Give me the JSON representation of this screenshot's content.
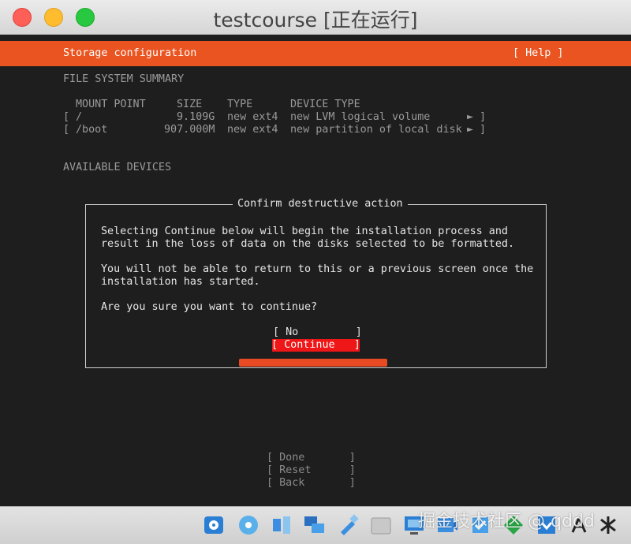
{
  "window": {
    "title": "testcourse [正在运行]"
  },
  "header": {
    "title": "Storage configuration",
    "help": "[ Help ]"
  },
  "fs_summary": {
    "heading": "FILE SYSTEM SUMMARY",
    "columns": [
      "MOUNT POINT",
      "SIZE",
      "TYPE",
      "DEVICE TYPE"
    ],
    "rows": [
      {
        "open": "[",
        "mount": "/",
        "size": "9.109G",
        "type": "new ext4",
        "device": "new LVM logical volume",
        "arrow": "►",
        "close": "]"
      },
      {
        "open": "[",
        "mount": "/boot",
        "size": "907.000M",
        "type": "new ext4",
        "device": "new partition of local disk",
        "arrow": "►",
        "close": "]"
      }
    ]
  },
  "available_devices": {
    "heading": "AVAILABLE DEVICES"
  },
  "dialog": {
    "title": "Confirm destructive action",
    "lines": [
      "Selecting Continue below will begin the installation process and",
      "result in the loss of data on the disks selected to be formatted.",
      "You will not be able to return to this or a previous screen once the",
      "installation has started.",
      "Are you sure you want to continue?"
    ],
    "no_button": "[ No         ]",
    "continue_button": "[ Continue   ]"
  },
  "menu": {
    "done": "[ Done       ]",
    "reset": "[ Reset      ]",
    "back": "[ Back       ]"
  },
  "dock": {
    "icons": [
      "hard-disk-icon",
      "optical-disc-icon",
      "audio-icon",
      "network-icon",
      "usb-icon",
      "shared-folder-icon",
      "display-icon",
      "recording-icon",
      "cpu-icon",
      "arrow-down-icon",
      "keyboard-icon",
      "command-key-icon"
    ]
  },
  "watermark": "掘金技术社区 @ qddd"
}
